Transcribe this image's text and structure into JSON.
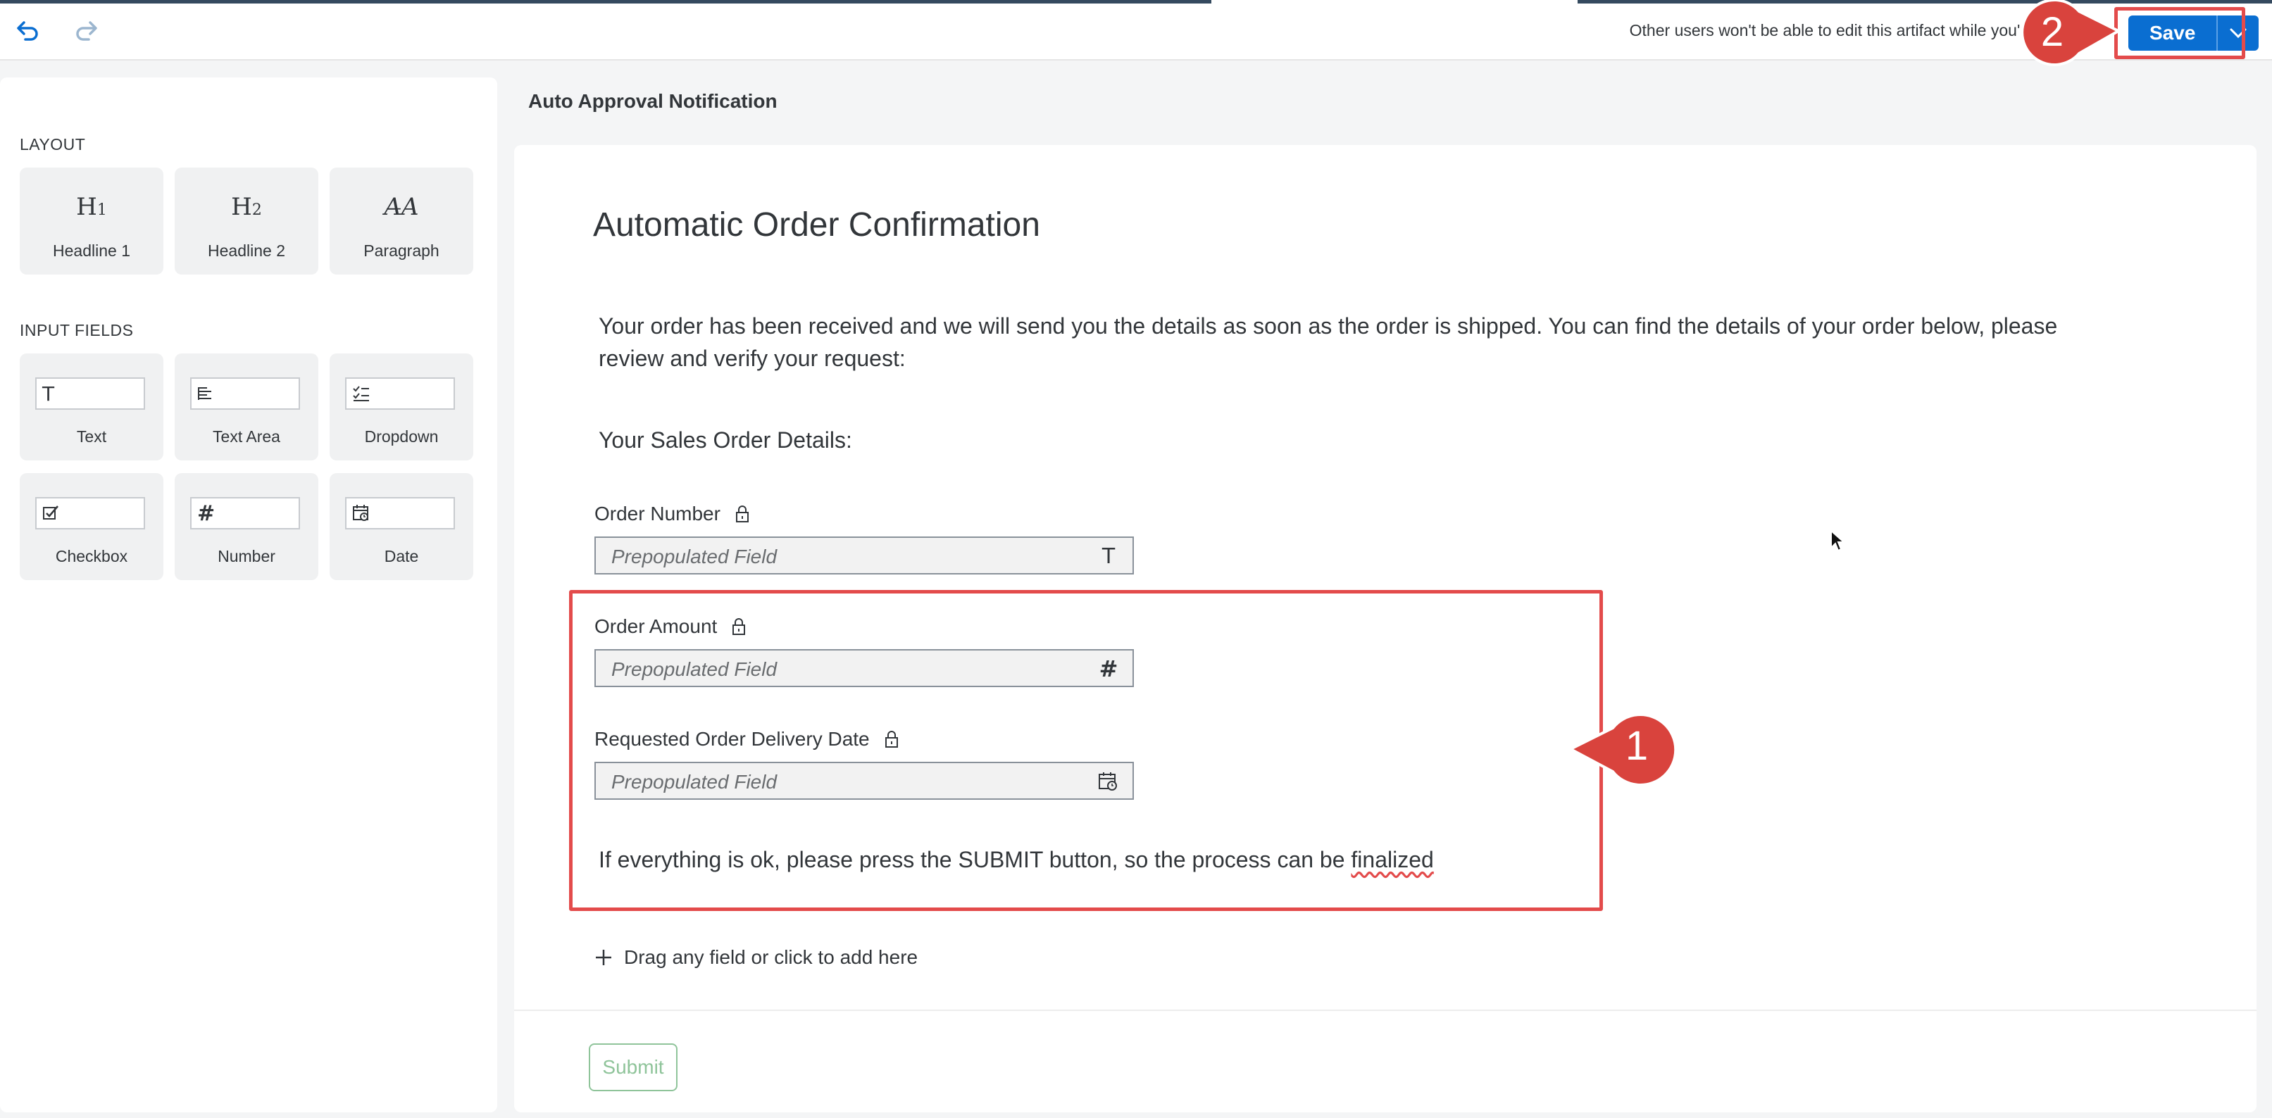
{
  "toolbar": {
    "lock_message": "Other users won't be able to edit this artifact while you'r",
    "save_label": "Save",
    "undo_icon": "undo-icon",
    "redo_icon": "redo-icon"
  },
  "palette": {
    "layout_title": "LAYOUT",
    "layout_items": [
      {
        "label": "Headline 1",
        "icon": "headline-1-icon"
      },
      {
        "label": "Headline 2",
        "icon": "headline-2-icon"
      },
      {
        "label": "Paragraph",
        "icon": "paragraph-icon"
      }
    ],
    "input_title": "INPUT FIELDS",
    "input_items": [
      {
        "label": "Text",
        "icon": "text-icon"
      },
      {
        "label": "Text Area",
        "icon": "text-area-icon"
      },
      {
        "label": "Dropdown",
        "icon": "dropdown-icon"
      },
      {
        "label": "Checkbox",
        "icon": "checkbox-icon"
      },
      {
        "label": "Number",
        "icon": "number-icon"
      },
      {
        "label": "Date",
        "icon": "date-icon"
      }
    ]
  },
  "form": {
    "artifact_name": "Auto Approval Notification",
    "title": "Automatic Order Confirmation",
    "intro": "Your order has been received and we will send you the details as soon as the order is shipped. You can find the details of your order below, please review and verify your request:",
    "section_heading": "Your Sales Order Details:",
    "fields": [
      {
        "label": "Order Number",
        "placeholder": "Prepopulated Field",
        "type_icon": "text-type-icon"
      },
      {
        "label": "Order Amount",
        "placeholder": "Prepopulated Field",
        "type_icon": "number-type-icon"
      },
      {
        "label": "Requested Order Delivery Date",
        "placeholder": "Prepopulated Field",
        "type_icon": "calendar-icon"
      }
    ],
    "closing_text_main": "If everything is ok, please press the SUBMIT button, so the process can be ",
    "closing_text_last": "finalized",
    "add_hint": "Drag any field or click to add here",
    "submit_label": "Submit"
  },
  "annotations": {
    "callout_1": "1",
    "callout_2": "2",
    "highlight_color": "#e34b4b"
  },
  "colors": {
    "accent": "#0a6ed1",
    "submit_disabled": "#8fc49a"
  }
}
